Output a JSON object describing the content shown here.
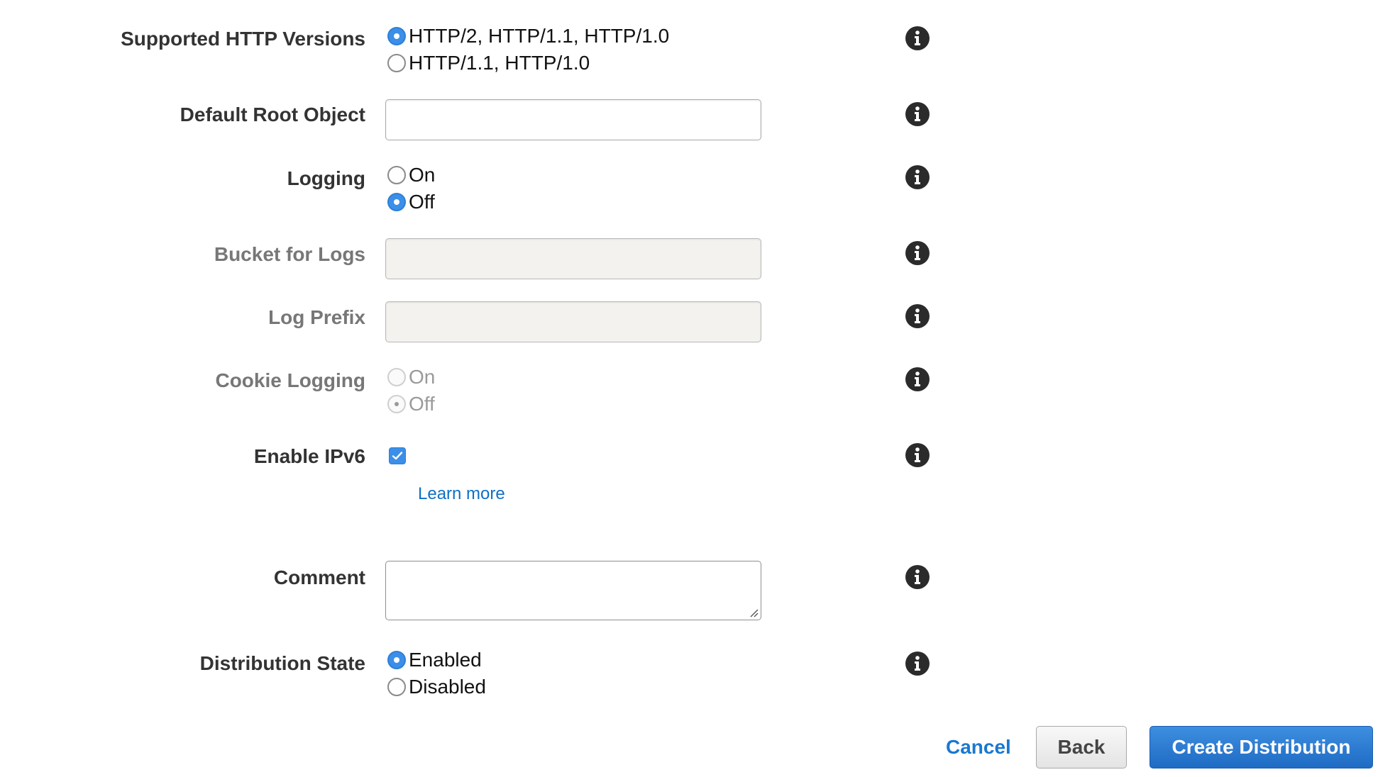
{
  "fields": {
    "http_versions": {
      "label": "Supported HTTP Versions",
      "options": [
        {
          "label": "HTTP/2, HTTP/1.1, HTTP/1.0",
          "checked": true
        },
        {
          "label": "HTTP/1.1, HTTP/1.0",
          "checked": false
        }
      ]
    },
    "default_root_object": {
      "label": "Default Root Object",
      "value": ""
    },
    "logging": {
      "label": "Logging",
      "options": [
        {
          "label": "On",
          "checked": false
        },
        {
          "label": "Off",
          "checked": true
        }
      ]
    },
    "bucket_for_logs": {
      "label": "Bucket for Logs",
      "value": "",
      "disabled": true
    },
    "log_prefix": {
      "label": "Log Prefix",
      "value": "",
      "disabled": true
    },
    "cookie_logging": {
      "label": "Cookie Logging",
      "disabled": true,
      "options": [
        {
          "label": "On",
          "checked": false
        },
        {
          "label": "Off",
          "checked": true
        }
      ]
    },
    "enable_ipv6": {
      "label": "Enable IPv6",
      "checked": true,
      "learn_more": "Learn more"
    },
    "comment": {
      "label": "Comment",
      "value": ""
    },
    "distribution_state": {
      "label": "Distribution State",
      "options": [
        {
          "label": "Enabled",
          "checked": true
        },
        {
          "label": "Disabled",
          "checked": false
        }
      ]
    }
  },
  "icons": {
    "info": "info-icon",
    "check": "checkmark-icon"
  },
  "actions": {
    "cancel_label": "Cancel",
    "back_label": "Back",
    "create_label": "Create Distribution"
  },
  "colors": {
    "accent": "#3b8fe8",
    "link": "#1a78d0",
    "primary_button": "#1f6bc4",
    "disabled_field": "#f3f2ee"
  }
}
